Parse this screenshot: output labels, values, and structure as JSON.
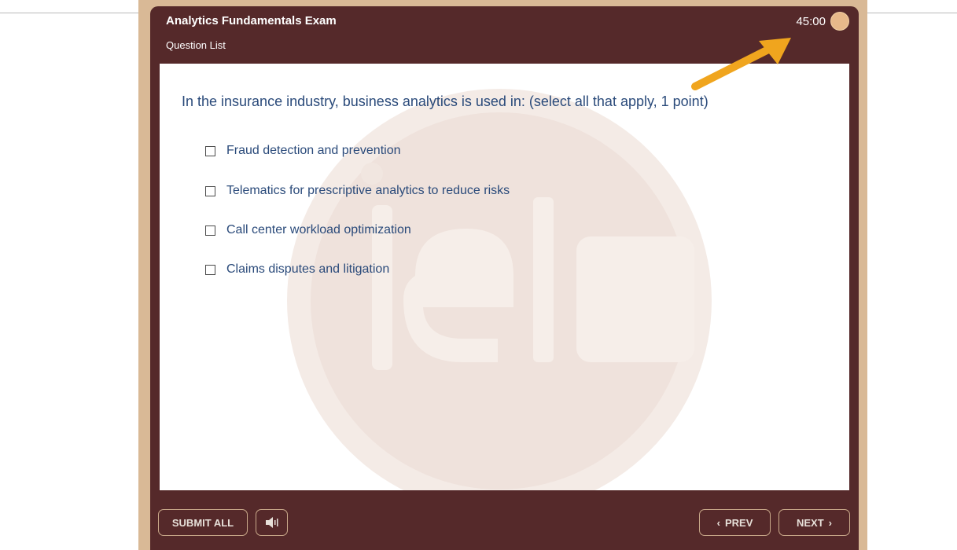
{
  "exam": {
    "title": "Analytics Fundamentals Exam",
    "subtitle": "Question List",
    "timer": "45:00"
  },
  "question": {
    "text": "In the insurance industry, business analytics is used in: (select all that apply, 1 point)",
    "options": [
      {
        "label": "Fraud detection and prevention",
        "checked": false
      },
      {
        "label": "Telematics for prescriptive analytics to reduce risks",
        "checked": false
      },
      {
        "label": "Call center workload optimization",
        "checked": false
      },
      {
        "label": "Claims disputes and litigation",
        "checked": false
      }
    ]
  },
  "footer": {
    "submit_label": "SUBMIT ALL",
    "prev_label": "PREV",
    "next_label": "NEXT",
    "prev_icon": "chevron-left-icon",
    "next_icon": "chevron-right-icon",
    "audio_icon": "speaker-icon"
  },
  "colors": {
    "header_bg": "#55292a",
    "frame": "#d9b996",
    "text_blue": "#2a4a7a",
    "timer_dot": "#e7b98a",
    "annotation_arrow": "#f0a51e"
  }
}
